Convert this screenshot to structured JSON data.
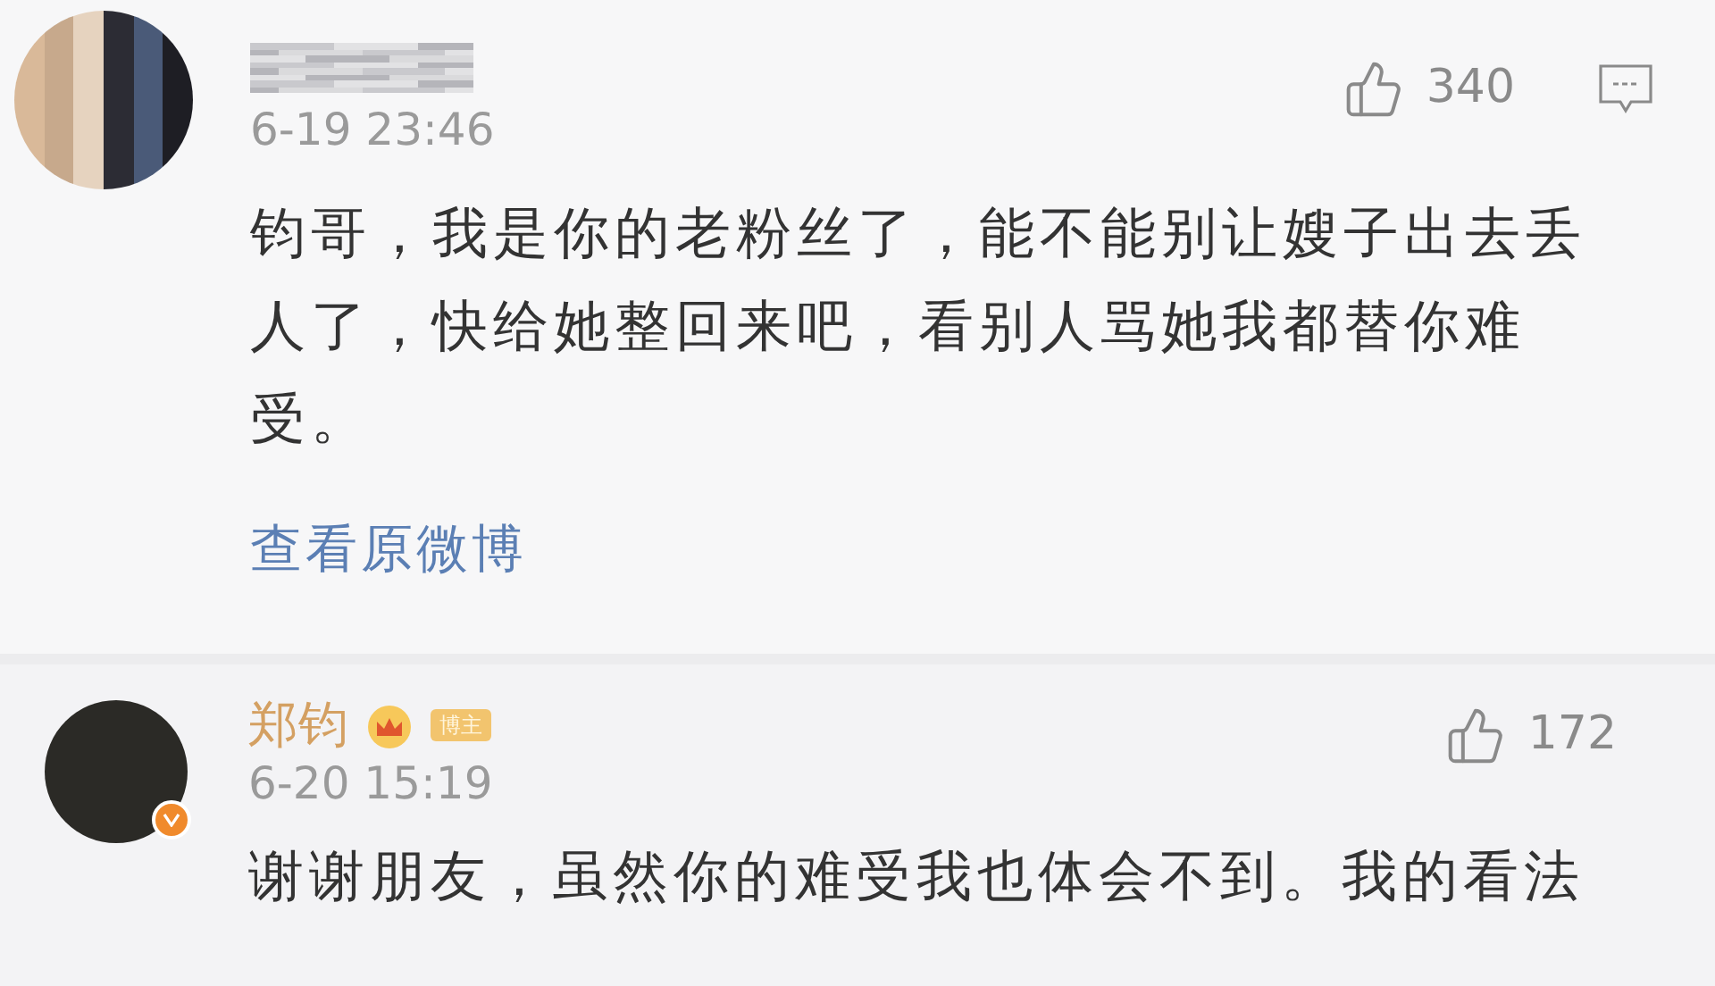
{
  "comments": [
    {
      "kind": "fan",
      "time": "6-19 23:46",
      "likes": "340",
      "text": "钧哥，我是你的老粉丝了，能不能别让嫂子出去丢人了，快给她整回来吧，看别人骂她我都替你难受。",
      "link": "查看原微博"
    },
    {
      "kind": "author",
      "name": "郑钧",
      "badge": "博主",
      "time": "6-20 15:19",
      "likes": "172",
      "text": "谢谢朋友，虽然你的难受我也体会不到。我的看法"
    }
  ]
}
